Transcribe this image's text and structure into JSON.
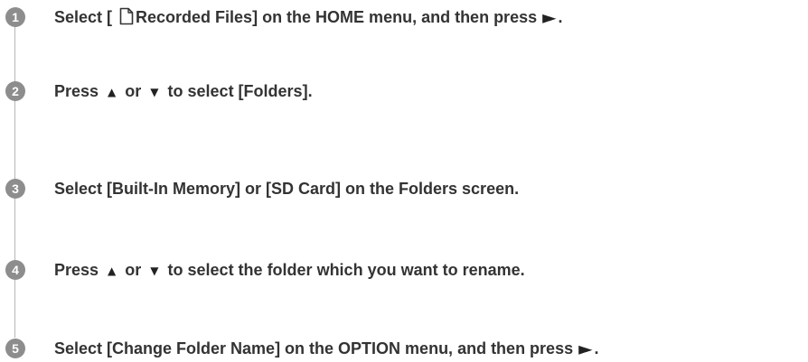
{
  "steps": [
    {
      "number": "1",
      "before_icon": "Select [",
      "icon": "document-icon",
      "after_icon": "Recorded Files] on the HOME menu, and then press",
      "end_symbol": "►",
      "end_text": "."
    },
    {
      "number": "2",
      "press": "Press",
      "up_symbol": "▲",
      "or": "or",
      "down_symbol": "▼",
      "rest": "to select [Folders]."
    },
    {
      "number": "3",
      "text": "Select [Built-In Memory] or [SD Card] on the Folders screen."
    },
    {
      "number": "4",
      "press": "Press",
      "up_symbol": "▲",
      "or": "or",
      "down_symbol": "▼",
      "rest": "to select the folder which you want to rename."
    },
    {
      "number": "5",
      "text": "Select [Change Folder Name] on the OPTION menu, and then press",
      "end_symbol": "►",
      "end_text": "."
    }
  ],
  "colors": {
    "badge": "#8d8d8d",
    "connector": "#b5b5b5",
    "text": "#333333"
  }
}
